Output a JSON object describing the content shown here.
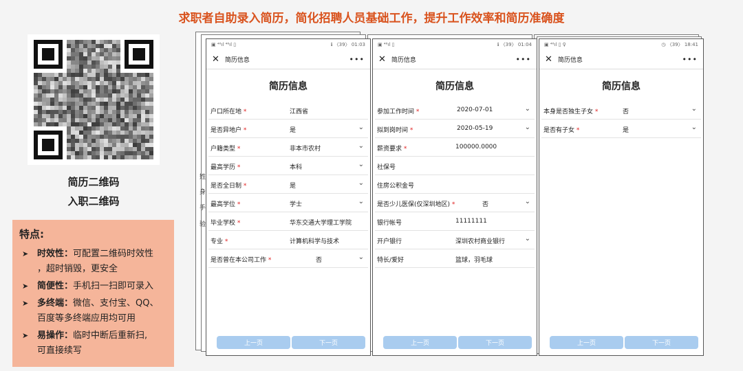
{
  "headline": "求职者自助录入简历，简化招聘人员基础工作，提升工作效率和简历准确度",
  "qr": {
    "label_resume": "简历二维码",
    "label_onboard": "入职二维码"
  },
  "features": {
    "title": "特点:",
    "items": [
      {
        "name": "时效性：",
        "desc": "可配置二维码时效性",
        "desc2": "，超时销毁，更安全"
      },
      {
        "name": "简便性：",
        "desc": "手机扫一扫即可录入"
      },
      {
        "name": "多终端：",
        "desc": "微信、支付宝、QQ、",
        "desc2": "百度等多终端应用均可用"
      },
      {
        "name": "易操作：",
        "desc": "临时中断后重新扫,",
        "desc2": "可直接续写"
      }
    ]
  },
  "phones": [
    {
      "status_left": "▣ ⁴⁶ıl ⁴⁶ıl ▯",
      "status_right": "ℹ 〈39〉 01:03",
      "nav_title": "简历信息",
      "page_title": "简历信息",
      "rows": [
        {
          "label": "户口所在地",
          "req": "*",
          "value": "江西省",
          "chev": ""
        },
        {
          "label": "是否异地户",
          "req": "*",
          "value": "是",
          "chev": "⌄"
        },
        {
          "label": "户籍类型",
          "req": "*",
          "value": "非本市农村",
          "chev": "⌄"
        },
        {
          "label": "最高学历",
          "req": "*",
          "value": "本科",
          "chev": "⌄"
        },
        {
          "label": "是否全日制",
          "req": "*",
          "value": "是",
          "chev": "⌄"
        },
        {
          "label": "最高学位",
          "req": "*",
          "value": "学士",
          "chev": "⌄"
        },
        {
          "label": "毕业学校",
          "req": "*",
          "value": "华东交通大学理工学院",
          "chev": ""
        },
        {
          "label": "专业",
          "req": "*",
          "value": "计算机科学与技术",
          "chev": ""
        },
        {
          "label": "是否曾在本公司工作",
          "req": "*",
          "value": "否",
          "chev": "⌄"
        }
      ],
      "prev": "上一页",
      "next": "下一页"
    },
    {
      "status_left": "▣ ⁴⁶ıl ▯",
      "status_right": "ℹ 〈39〉 01:04",
      "nav_title": "简历信息",
      "page_title": "简历信息",
      "rows": [
        {
          "label": "参加工作时间",
          "req": "*",
          "value": "2020-07-01",
          "chev": "⌄"
        },
        {
          "label": "拟到岗时间",
          "req": "*",
          "value": "2020-05-19",
          "chev": "⌄"
        },
        {
          "label": "薪资要求",
          "req": "*",
          "value": "100000.0000",
          "chev": ""
        },
        {
          "label": "社保号",
          "req": "",
          "value": "",
          "chev": ""
        },
        {
          "label": "住房公积金号",
          "req": "",
          "value": "",
          "chev": ""
        },
        {
          "label": "是否少儿医保(仅深圳地区)",
          "req": "*",
          "value": "否",
          "chev": "⌄"
        },
        {
          "label": "银行帐号",
          "req": "",
          "value": "11111111",
          "chev": ""
        },
        {
          "label": "开户银行",
          "req": "",
          "value": "深圳农村商业银行",
          "chev": "⌄"
        },
        {
          "label": "特长/爱好",
          "req": "",
          "value": "篮球，羽毛球",
          "chev": ""
        }
      ],
      "prev": "上一页",
      "next": "下一页"
    },
    {
      "status_left": "▣ ⁴⁶ıl ▯ ♀",
      "status_right": "◷ 〈39〉 18:41",
      "nav_title": "简历信息",
      "page_title": "简历信息",
      "rows": [
        {
          "label": "本身是否独生子女",
          "req": "*",
          "value": "否",
          "chev": "⌄"
        },
        {
          "label": "是否有子女",
          "req": "*",
          "value": "是",
          "chev": "⌄"
        }
      ],
      "prev": "上一页",
      "next": "下一页"
    }
  ],
  "behind_edge_chars": [
    "姓",
    "身",
    "手",
    "验"
  ]
}
